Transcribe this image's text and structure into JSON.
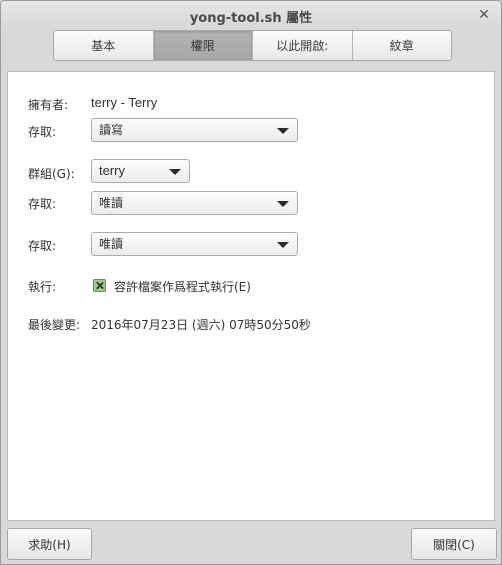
{
  "window": {
    "title": "yong-tool.sh 屬性",
    "close_glyph": "✕"
  },
  "tabs": [
    {
      "label": "基本",
      "active": false
    },
    {
      "label": "權限",
      "active": true
    },
    {
      "label": "以此開啟:",
      "active": false
    },
    {
      "label": "紋章",
      "active": false
    }
  ],
  "owner": {
    "label": "擁有者:",
    "value": "terry - Terry",
    "access_label": "存取:",
    "access_value": "讀寫"
  },
  "group": {
    "label": "群組(G):",
    "value": "terry",
    "access_label": "存取:",
    "access_value": "唯讀"
  },
  "others": {
    "access_label": "存取:",
    "access_value": "唯讀"
  },
  "execute": {
    "label": "執行:",
    "checkbox_label": "容許檔案作爲程式執行(E)",
    "checked": true
  },
  "last_changed": {
    "label": "最後變更:",
    "value": "2016年07月23日 (週六) 07時50分50秒"
  },
  "buttons": {
    "help_label": "求助(H)",
    "close_label": "關閉(C)"
  },
  "colors": {
    "checkbox_fill": "#a9c79b",
    "active_tab": "#acacac"
  }
}
